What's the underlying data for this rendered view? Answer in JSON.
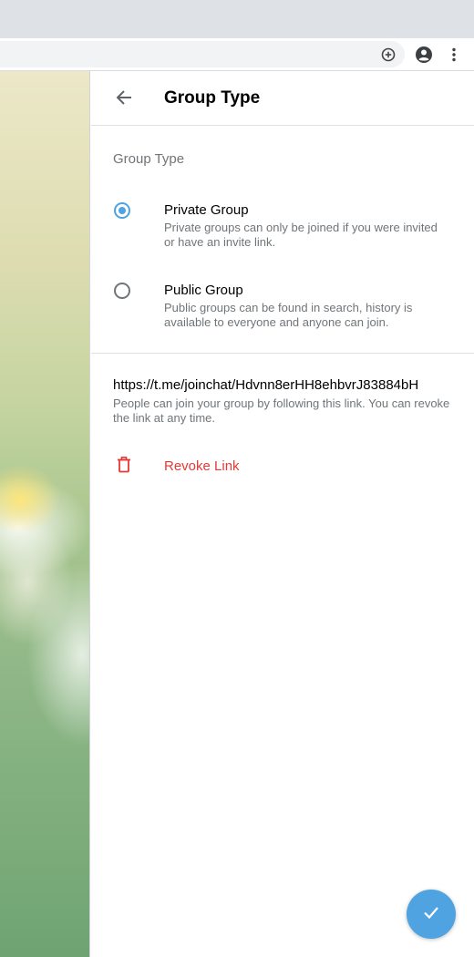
{
  "header": {
    "title": "Group Type"
  },
  "section": {
    "label": "Group Type"
  },
  "options": [
    {
      "title": "Private Group",
      "description": "Private groups can only be joined if you were invited or have an invite link.",
      "selected": true
    },
    {
      "title": "Public Group",
      "description": "Public groups can be found in search, history is available to everyone and anyone can join.",
      "selected": false
    }
  ],
  "invite": {
    "link": "https://t.me/joinchat/Hdvnn8erHH8ehbvrJ83884bH",
    "description": "People can join your group by following this link. You can revoke the link at any time.",
    "revoke_label": "Revoke Link"
  },
  "icons": {
    "back": "arrow-back-icon",
    "delete": "trash-icon",
    "confirm": "check-icon",
    "add": "plus-circle-icon",
    "profile": "account-circle-icon",
    "menu": "more-vert-icon"
  },
  "colors": {
    "accent": "#4fa3e0",
    "danger": "#e53935",
    "secondary_text": "#707579"
  }
}
